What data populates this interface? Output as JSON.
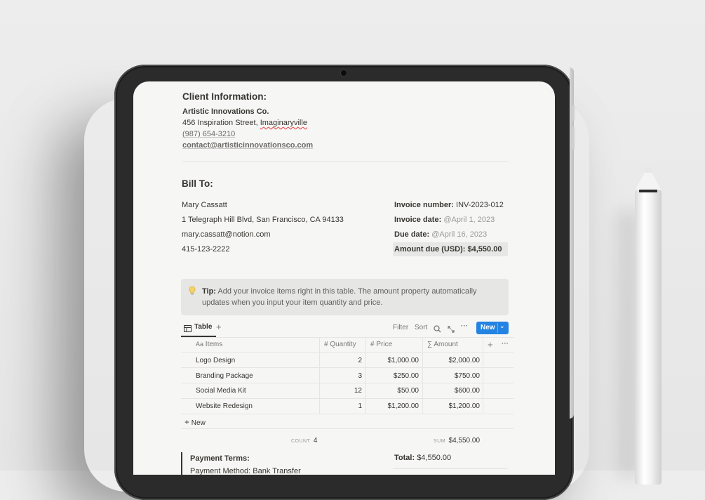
{
  "client": {
    "heading": "Client Information:",
    "company": "Artistic Innovations Co.",
    "address": "456 Inspiration Street, ",
    "city": "Imaginaryville",
    "phone": "(987) 654-3210",
    "email": "contact@artisticinnovationsco.com"
  },
  "bill_to": {
    "heading": "Bill To:",
    "name": "Mary Cassatt",
    "address": "1 Telegraph Hill Blvd, San Francisco, CA 94133",
    "email": "mary.cassatt@notion.com",
    "phone": "415-123-2222"
  },
  "invoice": {
    "number_label": "Invoice number:",
    "number": "INV-2023-012",
    "date_label": "Invoice date:",
    "date": "@April 1, 2023",
    "due_label": "Due date:",
    "due": "@April 16, 2023",
    "amount_label": "Amount due (USD):",
    "amount": "$4,550.00"
  },
  "tip": {
    "icon": "lightbulb-icon",
    "label": "Tip:",
    "line1": "Add your invoice items right in this table. The amount property automatically",
    "line2": "updates when you input your item quantity and price."
  },
  "table_view": {
    "tab_label": "Table",
    "add_view": "+",
    "filter": "Filter",
    "sort": "Sort",
    "new_label": "New",
    "more": "···"
  },
  "table": {
    "headers": {
      "items_icon": "Aa",
      "items": "Items",
      "quantity_icon": "#",
      "quantity": "Quantity",
      "price_icon": "#",
      "price": "Price",
      "amount_icon": "∑",
      "amount": "Amount",
      "add": "+",
      "more": "···"
    },
    "rows": [
      {
        "item": "Logo Design",
        "quantity": "2",
        "price": "$1,000.00",
        "amount": "$2,000.00"
      },
      {
        "item": "Branding Package",
        "quantity": "3",
        "price": "$250.00",
        "amount": "$750.00"
      },
      {
        "item": "Social Media Kit",
        "quantity": "12",
        "price": "$50.00",
        "amount": "$600.00"
      },
      {
        "item": "Website Redesign",
        "quantity": "1",
        "price": "$1,200.00",
        "amount": "$1,200.00"
      }
    ],
    "new_row": "New",
    "count_label": "COUNT",
    "count": "4",
    "sum_label": "SUM",
    "sum": "$4,550.00"
  },
  "footer": {
    "payment_terms": "Payment Terms:",
    "payment_method": "Payment Method: Bank Transfer",
    "total_label": "Total:",
    "total": "$4,550.00"
  }
}
